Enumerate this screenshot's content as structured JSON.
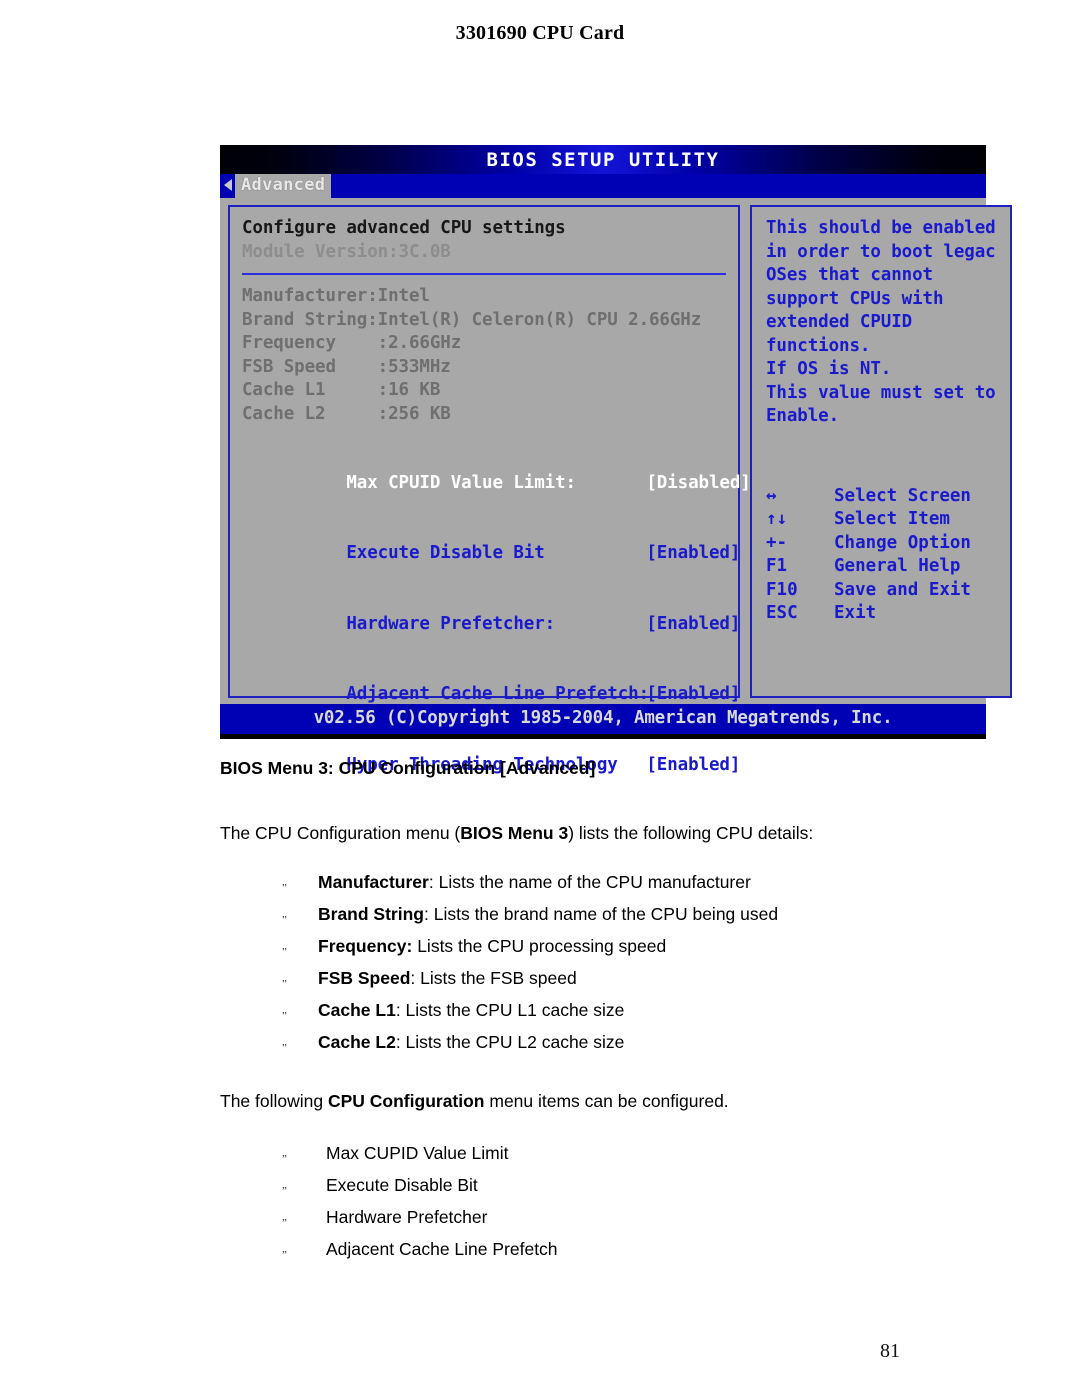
{
  "page": {
    "header_title": "3301690 CPU Card",
    "page_number": "81"
  },
  "bios": {
    "title": "BIOS SETUP UTILITY",
    "tab": "Advanced",
    "section_heading": "Configure advanced CPU settings",
    "module_version": "Module Version:3C.0B",
    "info_lines": [
      "Manufacturer:Intel",
      "Brand String:Intel(R) Celeron(R) CPU 2.66GHz",
      "Frequency    :2.66GHz",
      "FSB Speed    :533MHz",
      "Cache L1     :16 KB",
      "Cache L2     :256 KB"
    ],
    "settings": [
      {
        "label": "Max CPUID Value Limit:",
        "value": "[Disabled]",
        "selected": true
      },
      {
        "label": "Execute Disable Bit",
        "value": "[Enabled]",
        "selected": false
      },
      {
        "label": "Hardware Prefetcher:",
        "value": "[Enabled]",
        "selected": false
      },
      {
        "label": "Adjacent Cache Line Prefetch:",
        "value": "[Enabled]",
        "selected": false
      },
      {
        "label": "Hyper Threading Technology",
        "value": "[Enabled]",
        "selected": false
      }
    ],
    "help_lines": [
      "This should be enabled",
      "in order to boot legac",
      "OSes that cannot",
      "support CPUs with",
      "extended CPUID",
      "functions.",
      "If OS is NT.",
      "This value must set to",
      "Enable."
    ],
    "key_legend": [
      {
        "key": "↔",
        "action": "Select Screen"
      },
      {
        "key": "↑↓",
        "action": "Select Item"
      },
      {
        "key": "+-",
        "action": "Change Option"
      },
      {
        "key": "F1",
        "action": "General Help"
      },
      {
        "key": "F10",
        "action": "Save and Exit"
      },
      {
        "key": "ESC",
        "action": "Exit"
      }
    ],
    "footer": "v02.56 (C)Copyright 1985-2004, American Megatrends, Inc.",
    "colors": {
      "panel_bg": "#a8a8a8",
      "accent_blue": "#0000b4",
      "text_blue": "#1a1acd",
      "selected_white": "#ffffff"
    }
  },
  "prose": {
    "figure_caption": "BIOS Menu 3: CPU Configuration [Advanced]",
    "intro_before": "The CPU Configuration menu (",
    "intro_bold": "BIOS Menu 3",
    "intro_after": ") lists the following CPU details:",
    "details_bullets": [
      {
        "term": "Manufacturer",
        "sep": ": ",
        "desc": "Lists the name of the CPU manufacturer"
      },
      {
        "term": "Brand String",
        "sep": ": ",
        "desc": "Lists the brand name of the CPU being used"
      },
      {
        "term": "Frequency:",
        "sep": " ",
        "desc": "Lists the CPU processing speed"
      },
      {
        "term": "FSB Speed",
        "sep": ": ",
        "desc": "Lists the FSB speed"
      },
      {
        "term": "Cache L1",
        "sep": ": ",
        "desc": "Lists the CPU L1 cache size"
      },
      {
        "term": "Cache L2",
        "sep": ": ",
        "desc": "Lists the CPU L2 cache size"
      }
    ],
    "config_before": "The following ",
    "config_bold": "CPU Configuration",
    "config_after": " menu items can be configured.",
    "config_bullets": [
      "Max CUPID Value Limit",
      "Execute Disable Bit",
      "Hardware Prefetcher",
      "Adjacent Cache Line Prefetch"
    ],
    "bullet_glyph": "„"
  }
}
